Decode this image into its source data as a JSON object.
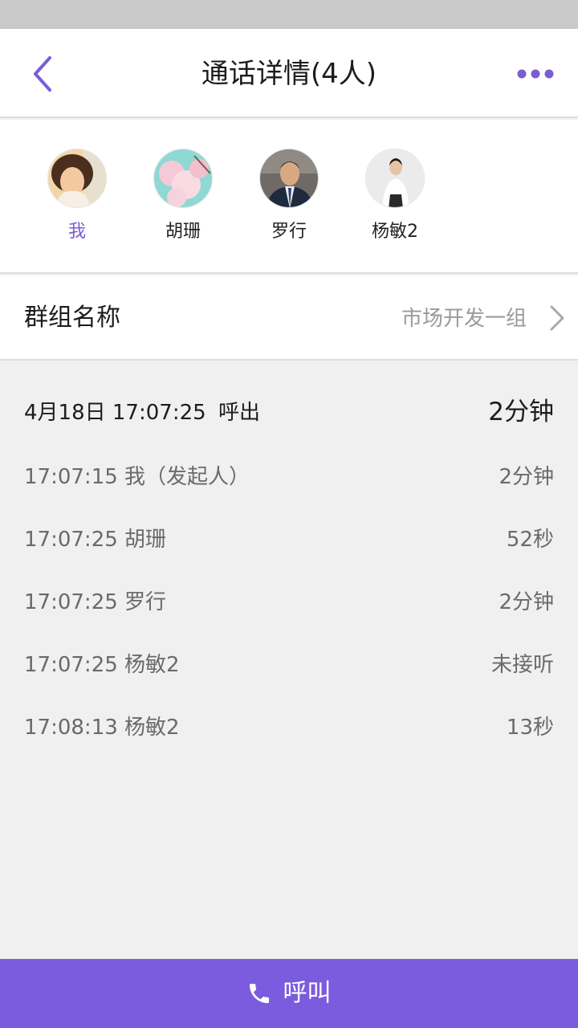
{
  "header": {
    "title": "通话详情(4人)",
    "back_icon": "chevron-left-icon",
    "more_icon": "more-dots-icon",
    "accent_color": "#7b5cd6"
  },
  "members": [
    {
      "name": "我",
      "avatar": "avatar-girl",
      "is_self": true
    },
    {
      "name": "胡珊",
      "avatar": "avatar-blossom",
      "is_self": false
    },
    {
      "name": "罗行",
      "avatar": "avatar-businessman",
      "is_self": false
    },
    {
      "name": "杨敏2",
      "avatar": "avatar-woman",
      "is_self": false
    }
  ],
  "group": {
    "label": "群组名称",
    "value": "市场开发一组",
    "arrow_icon": "chevron-right-icon"
  },
  "call": {
    "datetime": "4月18日 17:07:25",
    "direction": "呼出",
    "duration": "2分钟"
  },
  "log": [
    {
      "text": "17:07:15 我（发起人）",
      "duration": "2分钟"
    },
    {
      "text": "17:07:25 胡珊",
      "duration": "52秒"
    },
    {
      "text": "17:07:25 罗行",
      "duration": "2分钟"
    },
    {
      "text": "17:07:25 杨敏2",
      "duration": "未接听"
    },
    {
      "text": "17:08:13 杨敏2",
      "duration": "13秒"
    }
  ],
  "footer": {
    "call_label": "呼叫",
    "call_icon": "phone-icon",
    "bar_color": "#7b5cde"
  }
}
